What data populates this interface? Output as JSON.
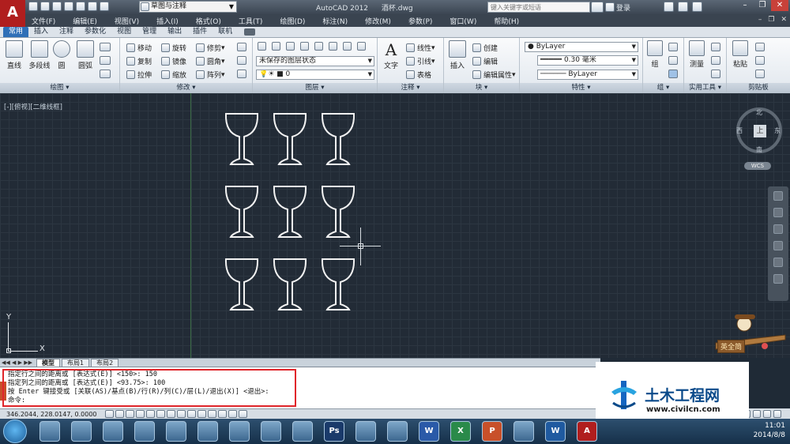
{
  "app": {
    "logo_letter": "A",
    "workspace": "草图与注释",
    "app_name": "AutoCAD 2012",
    "file_name": "酒杯.dwg",
    "search_placeholder": "键入关键字或短语",
    "login": "登录"
  },
  "menu": [
    "文件(F)",
    "编辑(E)",
    "视图(V)",
    "插入(I)",
    "格式(O)",
    "工具(T)",
    "绘图(D)",
    "标注(N)",
    "修改(M)",
    "参数(P)",
    "窗口(W)",
    "帮助(H)"
  ],
  "tabs": [
    "常用",
    "插入",
    "注释",
    "参数化",
    "视图",
    "管理",
    "输出",
    "插件",
    "联机"
  ],
  "active_tab": "常用",
  "ribbon": {
    "draw": {
      "title": "绘图",
      "line": "直线",
      "polyline": "多段线",
      "circle": "圆",
      "arc": "圆弧"
    },
    "modify": {
      "title": "修改",
      "move": "移动",
      "rotate": "旋转",
      "trim": "修剪",
      "copy": "复制",
      "mirror": "镜像",
      "fillet": "圆角",
      "stretch": "拉伸",
      "scale": "缩放",
      "array": "阵列"
    },
    "layers": {
      "title": "图层",
      "layer_state": "未保存的图层状态",
      "current_layer": "0"
    },
    "annotation": {
      "title": "注释",
      "text": "文字",
      "linear": "线性",
      "leader": "引线",
      "table": "表格"
    },
    "block": {
      "title": "块",
      "insert": "插入",
      "create": "创建",
      "edit": "编辑",
      "edit_attr": "编辑属性"
    },
    "properties": {
      "title": "特性",
      "color": "ByLayer",
      "lineweight": "0.30 毫米",
      "linetype": "ByLayer"
    },
    "groups": {
      "title": "组",
      "group": "组"
    },
    "utilities": {
      "title": "实用工具",
      "measure": "测量"
    },
    "clipboard": {
      "title": "剪贴板",
      "paste": "粘贴"
    }
  },
  "viewport": {
    "label": "[-][俯视][二维线框]",
    "viewcube": {
      "north": "北",
      "south": "南",
      "east": "东",
      "west": "西",
      "face": "上"
    },
    "wcs": "WCS",
    "ucs_x": "X",
    "ucs_y": "Y"
  },
  "layout_tabs": [
    "模型",
    "布局1",
    "布局2"
  ],
  "command_lines": [
    "指定行之间的距离或 [表达式(E)] <150>: 150",
    "指定列之间的距离或 [表达式(E)] <93.75>: 100",
    "按 Enter 键接受或 [关联(AS)/基点(B)/行(R)/列(C)/层(L)/退出(X)] <退出>:",
    "命令:"
  ],
  "status": {
    "coords": "346.2044,  228.0147, 0.0000"
  },
  "clock": {
    "time": "11:01",
    "date": "2014/8/8"
  },
  "ime": {
    "label": "英全简"
  },
  "watermark": {
    "title": "土木工程网",
    "url": "www.civilcn.com"
  },
  "taskbar_apps": [
    "chrome",
    "qq",
    "ie",
    "colors",
    "folder",
    "player",
    "media",
    "mail",
    "web",
    "ps",
    "bird",
    "paint",
    "word",
    "excel",
    "ppt",
    "brush",
    "wps",
    "autocad"
  ]
}
